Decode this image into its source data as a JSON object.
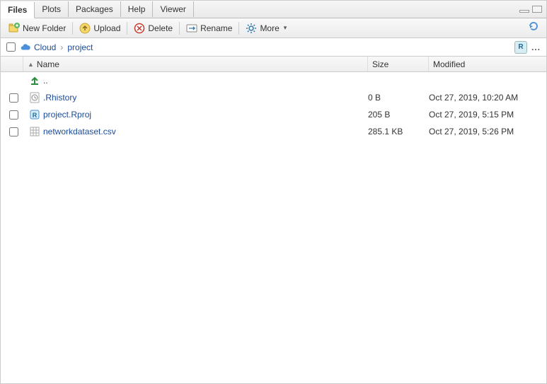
{
  "tabs": {
    "files": "Files",
    "plots": "Plots",
    "packages": "Packages",
    "help": "Help",
    "viewer": "Viewer"
  },
  "toolbar": {
    "new_folder": "New Folder",
    "upload": "Upload",
    "delete": "Delete",
    "rename": "Rename",
    "more": "More"
  },
  "breadcrumb": {
    "root": "Cloud",
    "current": "project"
  },
  "headers": {
    "name": "Name",
    "size": "Size",
    "modified": "Modified"
  },
  "parent_dir": "..",
  "files": [
    {
      "icon": "history",
      "name": ".Rhistory",
      "size": "0 B",
      "modified": "Oct 27, 2019, 10:20 AM"
    },
    {
      "icon": "rproj",
      "name": "project.Rproj",
      "size": "205 B",
      "modified": "Oct 27, 2019, 5:15 PM"
    },
    {
      "icon": "csv",
      "name": "networkdataset.csv",
      "size": "285.1 KB",
      "modified": "Oct 27, 2019, 5:26 PM"
    }
  ]
}
